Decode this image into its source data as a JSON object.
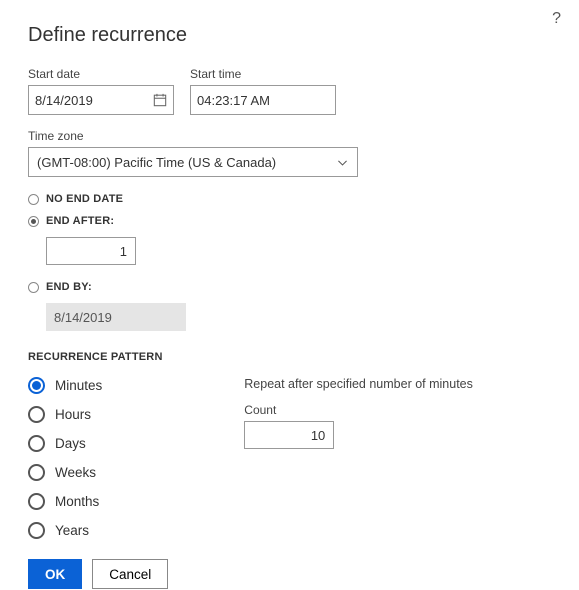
{
  "help_icon": "?",
  "title": "Define recurrence",
  "start_date": {
    "label": "Start date",
    "value": "8/14/2019"
  },
  "start_time": {
    "label": "Start time",
    "value": "04:23:17 AM"
  },
  "timezone": {
    "label": "Time zone",
    "value": "(GMT-08:00) Pacific Time (US & Canada)"
  },
  "end_options": {
    "no_end": {
      "label": "NO END DATE",
      "selected": false
    },
    "end_after": {
      "label": "END AFTER:",
      "selected": true,
      "value": "1"
    },
    "end_by": {
      "label": "END BY:",
      "selected": false,
      "value": "8/14/2019"
    }
  },
  "recurrence_heading": "RECURRENCE PATTERN",
  "pattern": {
    "options": {
      "minutes": "Minutes",
      "hours": "Hours",
      "days": "Days",
      "weeks": "Weeks",
      "months": "Months",
      "years": "Years"
    },
    "selected": "minutes",
    "desc": "Repeat after specified number of minutes",
    "count_label": "Count",
    "count_value": "10"
  },
  "buttons": {
    "ok": "OK",
    "cancel": "Cancel"
  }
}
